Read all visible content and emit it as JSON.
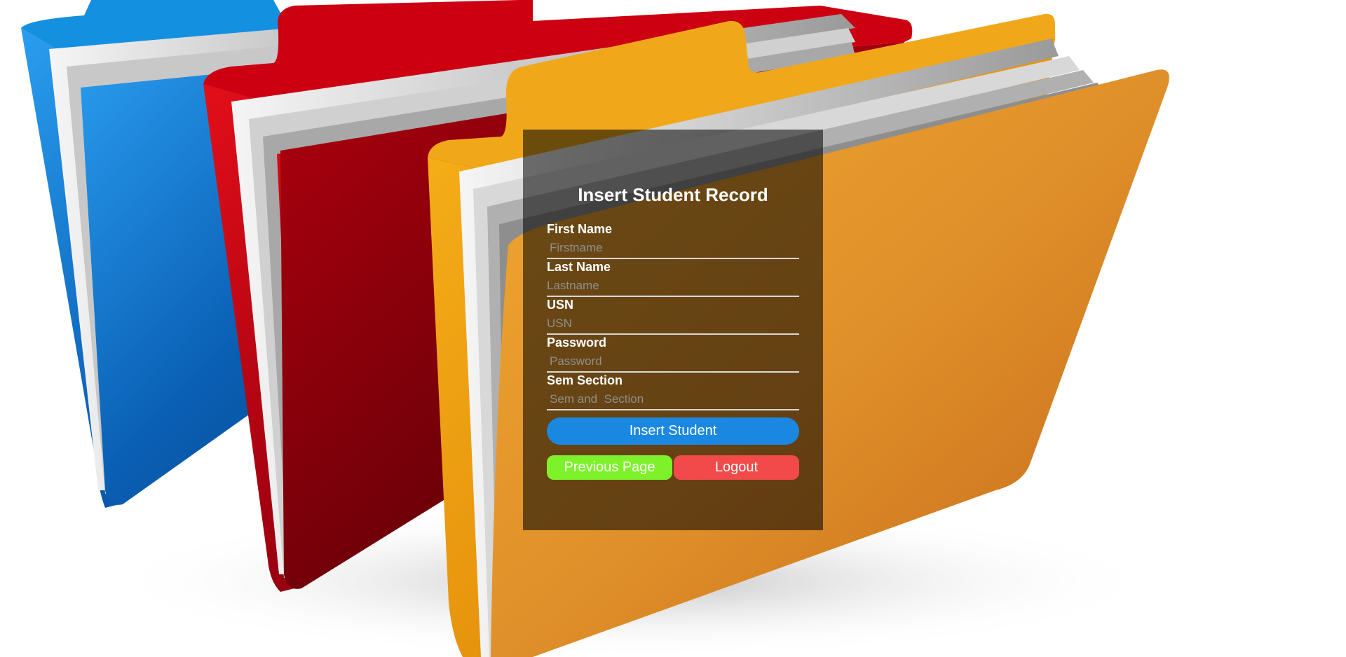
{
  "form": {
    "title": "Insert Student Record",
    "fields": [
      {
        "label": "First Name",
        "placeholder": "Firstname",
        "value": ""
      },
      {
        "label": "Last Name",
        "placeholder": "Lastname",
        "value": ""
      },
      {
        "label": "USN",
        "placeholder": "USN",
        "value": ""
      },
      {
        "label": "Password",
        "placeholder": "Password",
        "value": ""
      },
      {
        "label": "Sem Section",
        "placeholder": "Sem and  Section",
        "value": ""
      }
    ],
    "insert_button": "Insert Student",
    "previous_button": "Previous Page",
    "logout_button": "Logout"
  },
  "background": {
    "description_icon": "folders-illustration",
    "colors": {
      "blue_folder": "#0a5fb4",
      "red_folder": "#b30010",
      "yellow_folder": "#e8960e"
    }
  }
}
